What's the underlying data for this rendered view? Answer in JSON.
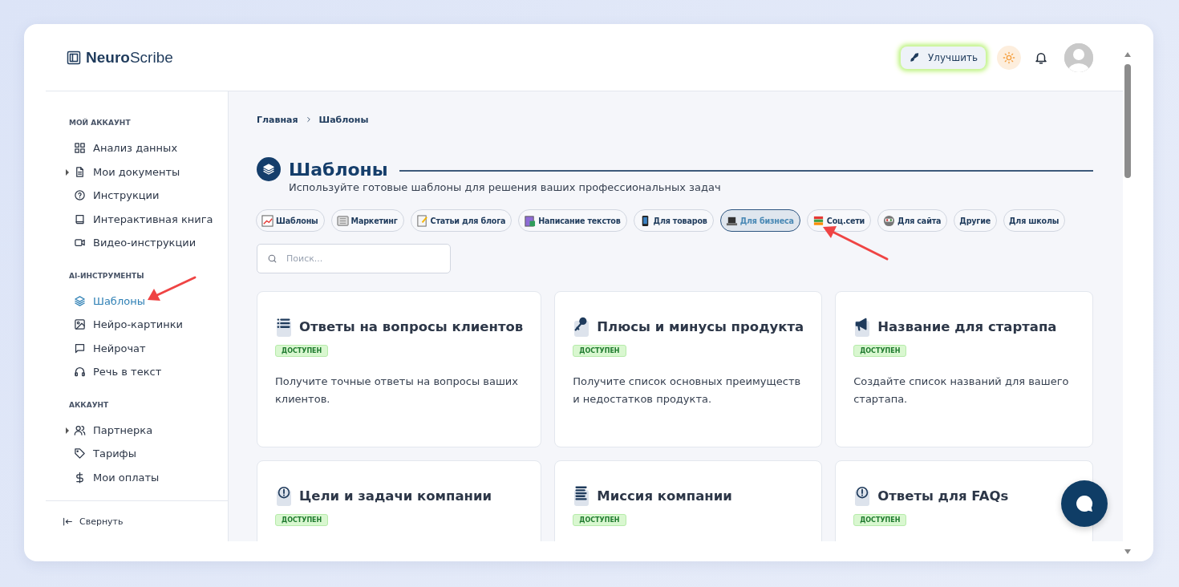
{
  "brand": {
    "bold": "Neuro",
    "light": "Scribe"
  },
  "header": {
    "upgrade_button": "Улучшить"
  },
  "sidebar": {
    "sections": [
      {
        "title": "МОЙ АККАУНТ",
        "items": [
          {
            "label": "Анализ данных",
            "selected": false,
            "expandable": false
          },
          {
            "label": "Мои документы",
            "selected": false,
            "expandable": true
          },
          {
            "label": "Инструкции",
            "selected": false,
            "expandable": false
          },
          {
            "label": "Интерактивная книга",
            "selected": false,
            "expandable": false
          },
          {
            "label": "Видео-инструкции",
            "selected": false,
            "expandable": false
          }
        ]
      },
      {
        "title": "AI-ИНСТРУМЕНТЫ",
        "items": [
          {
            "label": "Шаблоны",
            "selected": true,
            "expandable": false
          },
          {
            "label": "Нейро-картинки",
            "selected": false,
            "expandable": false
          },
          {
            "label": "Нейрочат",
            "selected": false,
            "expandable": false
          },
          {
            "label": "Речь в текст",
            "selected": false,
            "expandable": false
          }
        ]
      },
      {
        "title": "АККАУНТ",
        "items": [
          {
            "label": "Партнерка",
            "selected": false,
            "expandable": true
          },
          {
            "label": "Тарифы",
            "selected": false,
            "expandable": false
          },
          {
            "label": "Мои оплаты",
            "selected": false,
            "expandable": false
          }
        ]
      }
    ],
    "collapse_button": "Свернуть"
  },
  "breadcrumb": [
    "Главная",
    "Шаблоны"
  ],
  "page": {
    "title": "Шаблоны",
    "subtitle": "Используйте готовые шаблоны для решения ваших профессиональных задач"
  },
  "categories": [
    {
      "label": "Шаблоны",
      "selected": false
    },
    {
      "label": "Маркетинг",
      "selected": false
    },
    {
      "label": "Статьи для блога",
      "selected": false
    },
    {
      "label": "Написание текстов",
      "selected": false
    },
    {
      "label": "Для товаров",
      "selected": false
    },
    {
      "label": "Для бизнеса",
      "selected": true
    },
    {
      "label": "Соц.сети",
      "selected": false
    },
    {
      "label": "Для сайта",
      "selected": false
    },
    {
      "label": "Другие",
      "selected": false
    },
    {
      "label": "Для школы",
      "selected": false
    }
  ],
  "search": {
    "placeholder": "Поиск..."
  },
  "cards": [
    {
      "title": "Ответы на вопросы клиентов",
      "badge": "ДОСТУПЕН",
      "description": "Получите точные ответы на вопросы ваших клиентов."
    },
    {
      "title": "Плюсы и минусы продукта",
      "badge": "ДОСТУПЕН",
      "description": "Получите список основных преимуществ и недостатков продукта."
    },
    {
      "title": "Название для стартапа",
      "badge": "ДОСТУПЕН",
      "description": "Создайте список названий для вашего стартапа."
    },
    {
      "title": "Цели и задачи компании",
      "badge": "ДОСТУПЕН"
    },
    {
      "title": "Миссия компании",
      "badge": "ДОСТУПЕН"
    },
    {
      "title": "Ответы для FAQs",
      "badge": "ДОСТУПЕН"
    }
  ]
}
